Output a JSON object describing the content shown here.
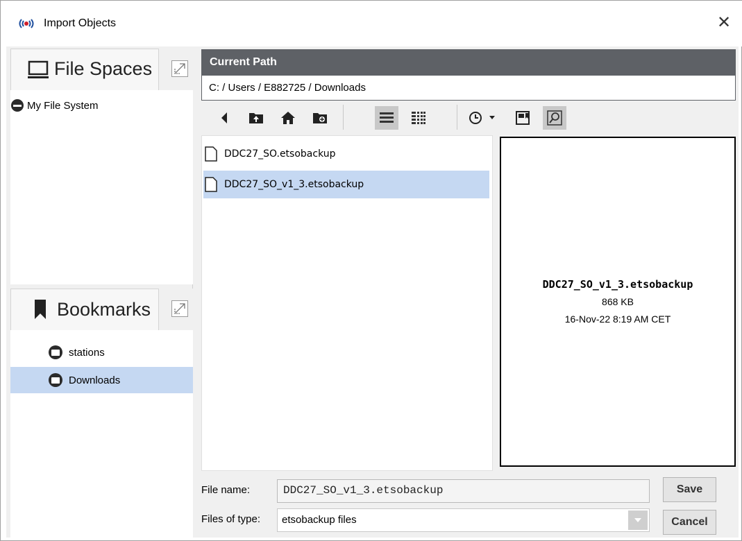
{
  "window": {
    "title": "Import Objects"
  },
  "file_spaces": {
    "title": "File Spaces",
    "items": [
      {
        "label": "My File System",
        "icon": "drive-icon"
      }
    ]
  },
  "bookmarks": {
    "title": "Bookmarks",
    "items": [
      {
        "label": "stations",
        "icon": "folder-icon",
        "selected": false
      },
      {
        "label": "Downloads",
        "icon": "folder-icon",
        "selected": true
      }
    ]
  },
  "current_path": {
    "header": "Current Path",
    "value": "C: / Users / E882725 / Downloads"
  },
  "toolbar": {
    "buttons": [
      "back-icon",
      "parent-folder-icon",
      "home-icon",
      "new-folder-icon",
      "list-view-icon",
      "grid-view-icon",
      "history-icon",
      "dropdown-arrow-icon",
      "bookmark-add-icon",
      "preview-toggle-icon"
    ],
    "active": [
      "list-view-icon",
      "preview-toggle-icon"
    ]
  },
  "files": [
    {
      "name": "DDC27_SO.etsobackup",
      "selected": false
    },
    {
      "name": "DDC27_SO_v1_3.etsobackup",
      "selected": true
    }
  ],
  "preview": {
    "name": "DDC27_SO_v1_3.etsobackup",
    "size": "868 KB",
    "date": "16-Nov-22 8:19 AM CET"
  },
  "form": {
    "file_name_label": "File name:",
    "file_name_value": "DDC27_SO_v1_3.etsobackup",
    "file_type_label": "Files of type:",
    "file_type_value": "etsobackup files",
    "save_label": "Save",
    "cancel_label": "Cancel"
  },
  "colors": {
    "selection": "#c5d8f2",
    "header_bg": "#5e6166",
    "panel_bg": "#f0f0f0"
  }
}
